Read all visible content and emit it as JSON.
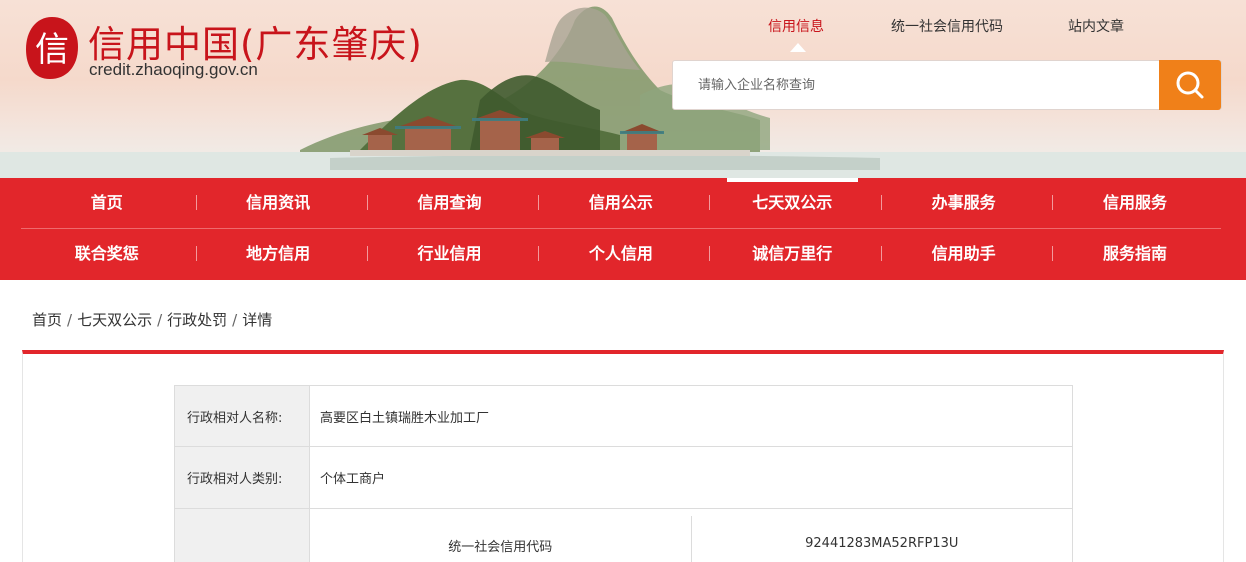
{
  "site": {
    "logo_char": "信",
    "title": "信用中国(广东肇庆)",
    "domain": "credit.zhaoqing.gov.cn"
  },
  "top_links": [
    {
      "label": "信用信息",
      "active": true
    },
    {
      "label": "统一社会信用代码",
      "active": false
    },
    {
      "label": "站内文章",
      "active": false
    }
  ],
  "search": {
    "placeholder": "请输入企业名称查询",
    "value": "",
    "button_icon": "search-icon"
  },
  "nav": {
    "row1": [
      "首页",
      "信用资讯",
      "信用查询",
      "信用公示",
      "七天双公示",
      "办事服务",
      "信用服务"
    ],
    "row2": [
      "联合奖惩",
      "地方信用",
      "行业信用",
      "个人信用",
      "诚信万里行",
      "信用助手",
      "服务指南"
    ],
    "current": "七天双公示"
  },
  "breadcrumb": [
    "首页",
    "七天双公示",
    "行政处罚",
    "详情"
  ],
  "detail": {
    "rows": [
      {
        "label": "行政相对人名称:",
        "value": "高要区白土镇瑞胜木业加工厂"
      },
      {
        "label": "行政相对人类别:",
        "value": "个体工商户"
      }
    ],
    "code_row": {
      "label": "",
      "sub_label": "统一社会信用代码",
      "sub_value": "92441283MA52RFP13U"
    }
  },
  "colors": {
    "brand_red": "#e2262b",
    "title_red": "#c8141b",
    "search_orange": "#f08019"
  }
}
